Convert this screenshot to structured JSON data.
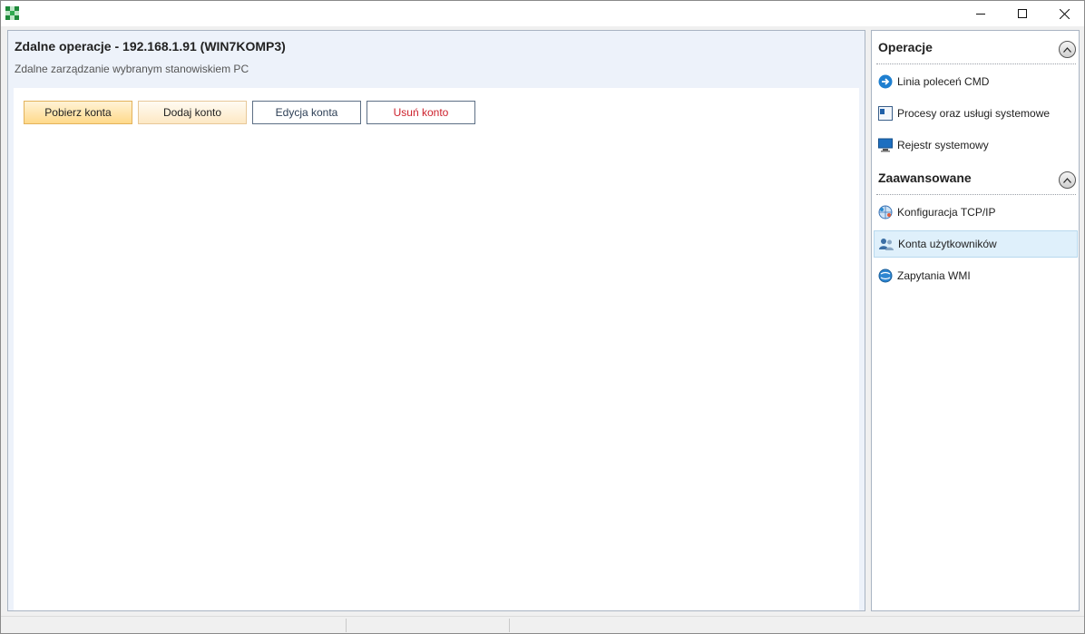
{
  "window": {
    "controls": {
      "minimize_icon": "minimize-icon",
      "maximize_icon": "maximize-icon",
      "close_icon": "close-icon"
    }
  },
  "main": {
    "title": "Zdalne operacje - 192.168.1.91 (WIN7KOMP3)",
    "subtitle": "Zdalne zarządzanie wybranym stanowiskiem PC",
    "buttons": {
      "get_accounts": "Pobierz konta",
      "add_account": "Dodaj konto",
      "edit_account": "Edycja konta",
      "delete_account": "Usuń konto"
    }
  },
  "sidebar": {
    "sections": [
      {
        "title": "Operacje",
        "items": [
          {
            "label": "Linia poleceń CMD",
            "icon": "arrow-right-icon"
          },
          {
            "label": "Procesy oraz usługi systemowe",
            "icon": "process-window-icon"
          },
          {
            "label": "Rejestr systemowy",
            "icon": "monitor-icon"
          }
        ]
      },
      {
        "title": "Zaawansowane",
        "items": [
          {
            "label": "Konfiguracja TCP/IP",
            "icon": "network-globe-icon"
          },
          {
            "label": "Konta użytkowników",
            "icon": "users-icon",
            "selected": true
          },
          {
            "label": "Zapytania WMI",
            "icon": "wmi-globe-icon"
          }
        ]
      }
    ]
  },
  "colors": {
    "header_bg": "#edf2fa",
    "panel_border": "#a9b4c2",
    "primary_btn": "#ffd98a",
    "delete_text": "#cc1f2b",
    "selected_item": "#dff0fb"
  }
}
